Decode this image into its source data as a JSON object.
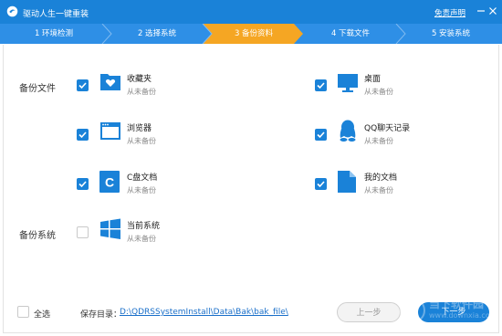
{
  "window": {
    "title": "驱动人生一键重装",
    "disclaimer": "免责声明"
  },
  "steps": [
    {
      "label": "1 环境检测",
      "active": false
    },
    {
      "label": "2 选择系统",
      "active": false
    },
    {
      "label": "3 备份资料",
      "active": true
    },
    {
      "label": "4 下载文件",
      "active": false
    },
    {
      "label": "5 安装系统",
      "active": false
    }
  ],
  "sections": {
    "backup_files": "备份文件",
    "backup_system": "备份系统"
  },
  "items": {
    "favorites": {
      "name": "收藏夹",
      "status": "从未备份",
      "checked": true
    },
    "desktop": {
      "name": "桌面",
      "status": "从未备份",
      "checked": true
    },
    "browser": {
      "name": "浏览器",
      "status": "从未备份",
      "checked": true
    },
    "qq": {
      "name": "QQ聊天记录",
      "status": "从未备份",
      "checked": true
    },
    "cdrive": {
      "name": "C盘文档",
      "status": "从未备份",
      "checked": true
    },
    "mydocs": {
      "name": "我的文档",
      "status": "从未备份",
      "checked": true
    },
    "system": {
      "name": "当前系统",
      "status": "从未备份",
      "checked": false
    }
  },
  "footer": {
    "select_all": "全选",
    "save_label": "保存目录：",
    "save_path": "D:\\QDRSSystemInstall\\Data\\Bak\\bak_file\\",
    "prev": "上一步",
    "next": "下一步"
  },
  "watermark": {
    "title": "当下软件园",
    "sub": "www.downxia.com"
  },
  "colors": {
    "accent": "#1a82d8",
    "active_step": "#f5a623",
    "step_bar": "#2e8fe6"
  },
  "icons": [
    "app-logo-icon",
    "minimize-icon",
    "close-icon",
    "folder-heart-icon",
    "monitor-icon",
    "browser-window-icon",
    "qq-penguin-icon",
    "c-drive-doc-icon",
    "document-icon",
    "windows-logo-icon",
    "check-icon"
  ]
}
